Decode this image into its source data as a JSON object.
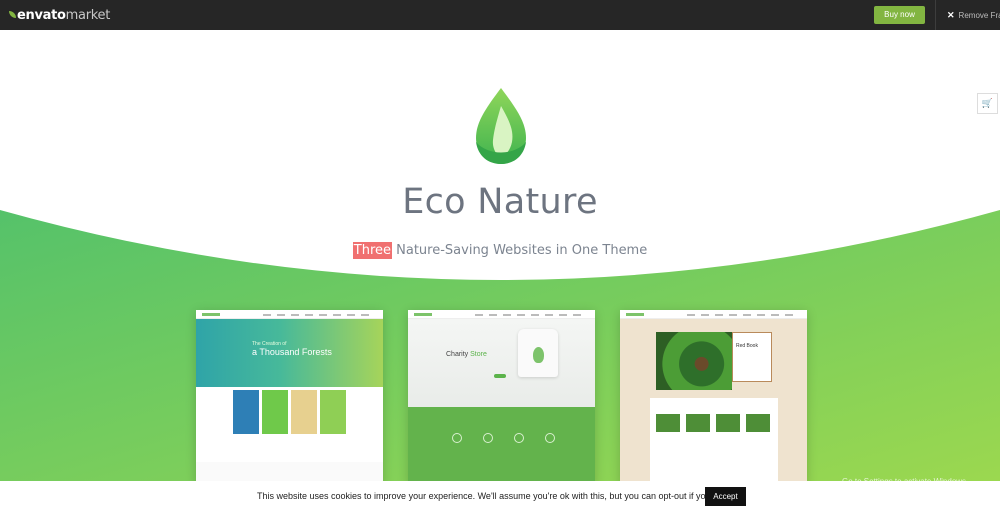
{
  "topbar": {
    "brand_bold": "envato",
    "brand_light": "market",
    "buy_label": "Buy now",
    "remove_label": "Remove Frame"
  },
  "hero": {
    "title": "Eco Nature",
    "subtitle_highlight": "Three",
    "subtitle_rest": " Nature-Saving Websites in One Theme"
  },
  "previews": [
    {
      "heading_small": "The Creation of",
      "heading_big": "a Thousand Forests"
    },
    {
      "heading": "Charity",
      "heading_accent": "Store"
    },
    {
      "book_title": "Red Book"
    }
  ],
  "cookie": {
    "text": "This website uses cookies to improve your experience. We'll assume you're ok with this, but you can opt-out if you wish",
    "accept_label": "Accept"
  },
  "watermark": "Go to Settings to activate Windows.",
  "colors": {
    "accent_green": "#82b541",
    "highlight_red": "#f07070",
    "topbar": "#262626"
  }
}
